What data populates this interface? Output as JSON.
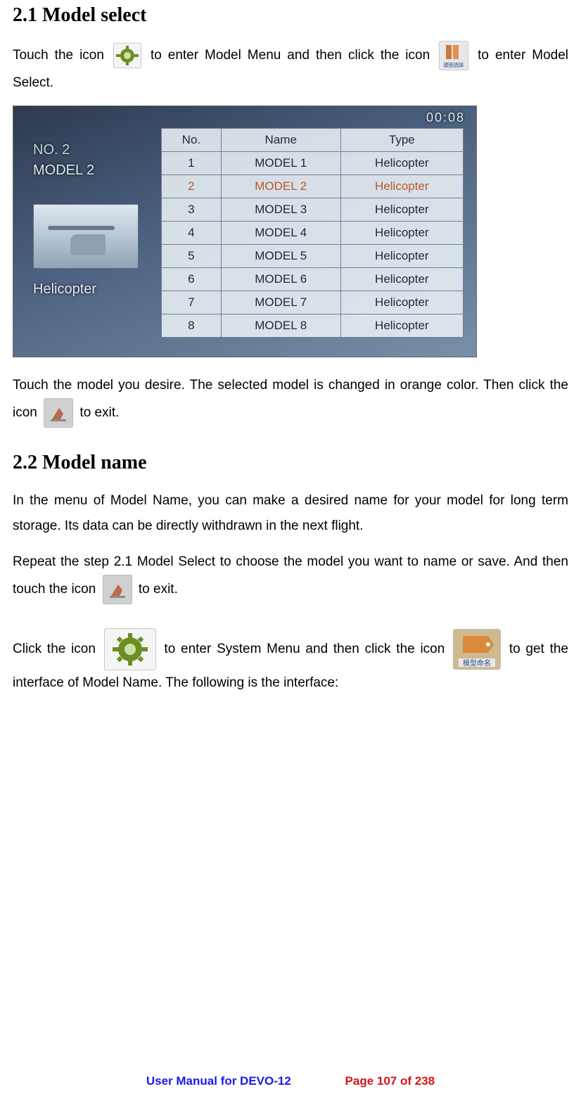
{
  "sections": {
    "s21_title": "2.1 Model select",
    "s22_title": "2.2 Model name"
  },
  "p1a": "Touch the icon ",
  "p1b": " to enter Model Menu and then click the icon ",
  "p1c": " to enter Model Select.",
  "p2a": "Touch the model you desire. The selected model is changed in orange color. Then click the icon ",
  "p2b": " to exit.",
  "p3": "In the menu of Model Name, you can make a desired name for your model for long term storage. Its data can be directly withdrawn in the next flight.",
  "p4a": "Repeat the step 2.1 Model Select to choose the model you want to name or save. And then touch the icon ",
  "p4b": " to exit.",
  "p5a": "Click the icon ",
  "p5b": " to enter System Menu and then click the icon ",
  "p5c": " to get the interface of Model Name. The following is the interface:",
  "screenshot": {
    "clock": "00:08",
    "left_no": "NO. 2",
    "left_name": "MODEL 2",
    "left_type": "Helicopter",
    "headers": {
      "no": "No.",
      "name": "Name",
      "type": "Type"
    },
    "rows": [
      {
        "no": "1",
        "name": "MODEL 1",
        "type": "Helicopter",
        "selected": false
      },
      {
        "no": "2",
        "name": "MODEL 2",
        "type": "Helicopter",
        "selected": true
      },
      {
        "no": "3",
        "name": "MODEL 3",
        "type": "Helicopter",
        "selected": false
      },
      {
        "no": "4",
        "name": "MODEL 4",
        "type": "Helicopter",
        "selected": false
      },
      {
        "no": "5",
        "name": "MODEL 5",
        "type": "Helicopter",
        "selected": false
      },
      {
        "no": "6",
        "name": "MODEL 6",
        "type": "Helicopter",
        "selected": false
      },
      {
        "no": "7",
        "name": "MODEL 7",
        "type": "Helicopter",
        "selected": false
      },
      {
        "no": "8",
        "name": "MODEL 8",
        "type": "Helicopter",
        "selected": false
      }
    ]
  },
  "icon_captions": {
    "model_select": "模型选择",
    "model_name": "模型命名"
  },
  "footer": {
    "left": "User Manual for DEVO-12",
    "right": "Page 107 of 238"
  }
}
